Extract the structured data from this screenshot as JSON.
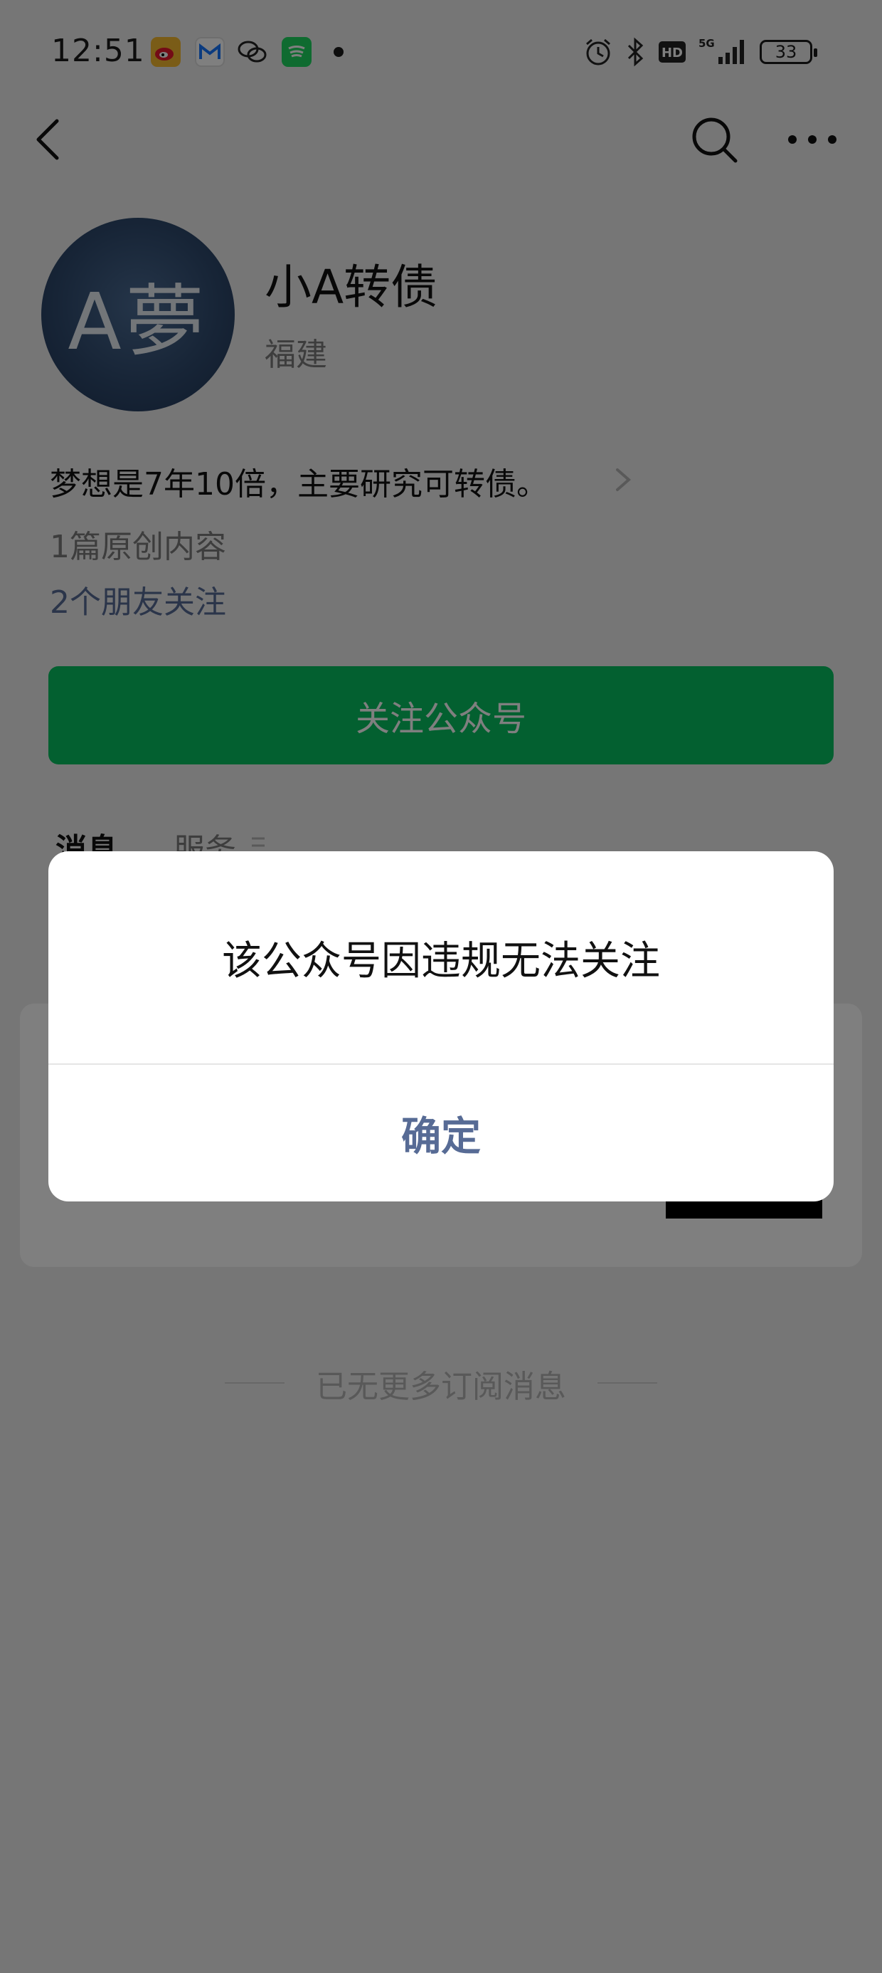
{
  "status_bar": {
    "time": "12:51",
    "battery": "33",
    "icons": [
      "weibo-icon",
      "mail-icon",
      "wechat-icon",
      "spotify-icon",
      "alarm-icon",
      "bluetooth-icon",
      "hd-icon",
      "signal-5g-icon",
      "battery-icon"
    ]
  },
  "nav": {
    "back_icon": "chevron-left-icon",
    "search_icon": "search-icon",
    "more_icon": "more-dots-icon"
  },
  "profile": {
    "avatar_text": "A夢",
    "name": "小A转债",
    "region": "福建",
    "bio": "梦想是7年10倍，主要研究可转债。",
    "original_count": "1篇原创内容",
    "friends_follow": "2个朋友关注",
    "follow_button": "关注公众号"
  },
  "tabs": {
    "messages": "消息",
    "services": "服务"
  },
  "footer": {
    "no_more": "已无更多订阅消息"
  },
  "dialog": {
    "message": "该公众号因违规无法关注",
    "confirm": "确定"
  },
  "colors": {
    "brand_green": "#07c160",
    "link_blue": "#576b95",
    "background": "#ededed"
  }
}
